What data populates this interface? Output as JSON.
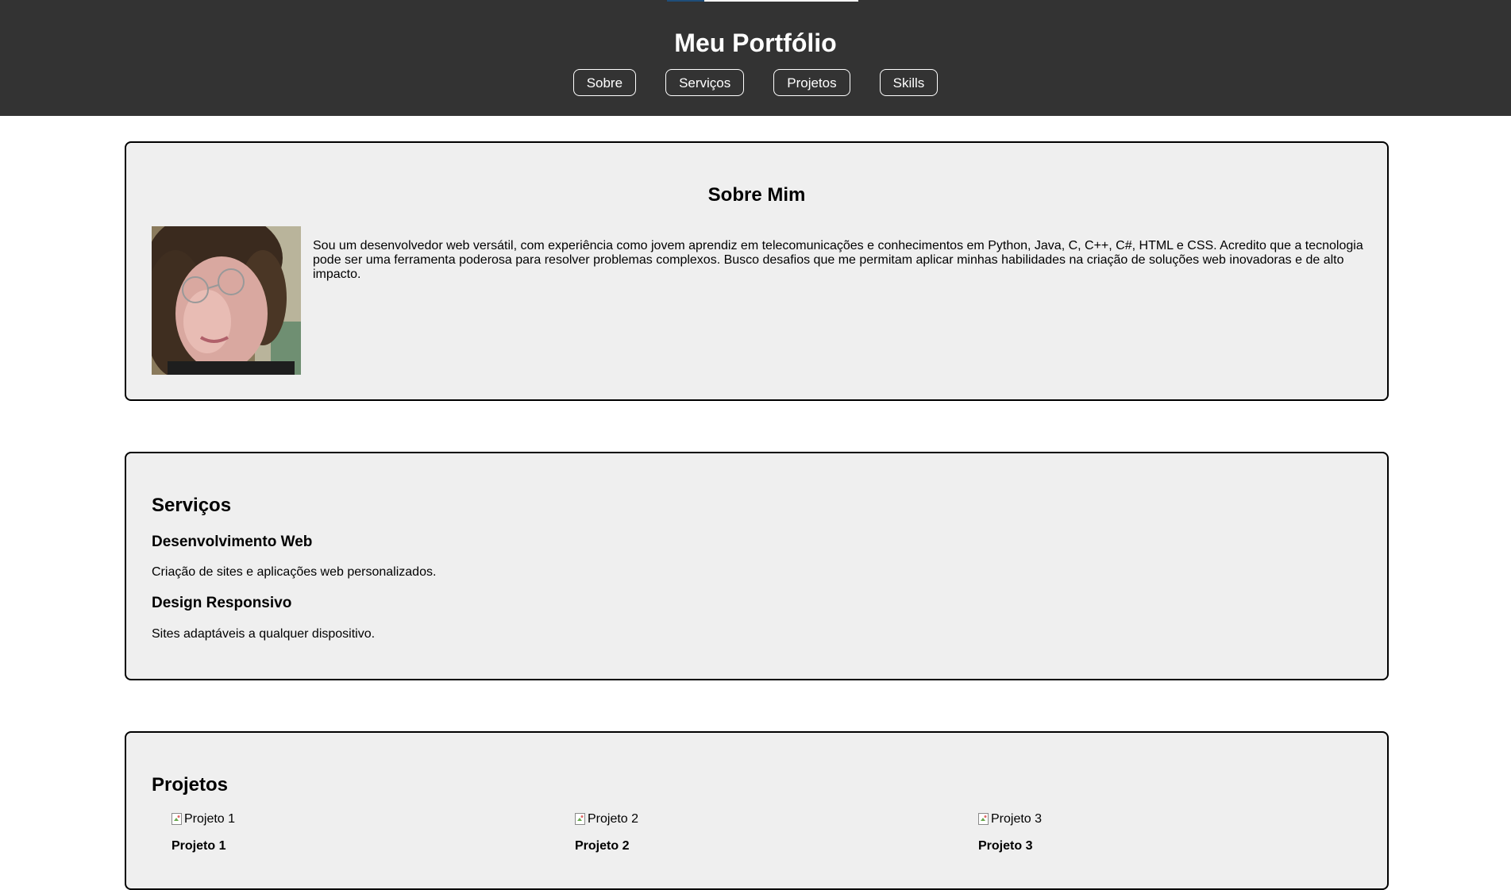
{
  "header": {
    "title": "Meu Portfólio",
    "nav": [
      {
        "label": "Sobre"
      },
      {
        "label": "Serviços"
      },
      {
        "label": "Projetos"
      },
      {
        "label": "Skills"
      }
    ]
  },
  "sobre": {
    "title": "Sobre Mim",
    "text": "Sou um desenvolvedor web versátil, com experiência como jovem aprendiz em telecomunicações e conhecimentos em Python, Java, C, C++, C#, HTML e CSS. Acredito que a tecnologia pode ser uma ferramenta poderosa para resolver problemas complexos. Busco desafios que me permitam aplicar minhas habilidades na criação de soluções web inovadoras e de alto impacto."
  },
  "servicos": {
    "title": "Serviços",
    "items": [
      {
        "title": "Desenvolvimento Web",
        "desc": "Criação de sites e aplicações web personalizados."
      },
      {
        "title": "Design Responsivo",
        "desc": "Sites adaptáveis a qualquer dispositivo."
      }
    ]
  },
  "projetos": {
    "title": "Projetos",
    "items": [
      {
        "alt": "Projeto 1",
        "name": "Projeto 1"
      },
      {
        "alt": "Projeto 2",
        "name": "Projeto 2"
      },
      {
        "alt": "Projeto 3",
        "name": "Projeto 3"
      }
    ]
  }
}
